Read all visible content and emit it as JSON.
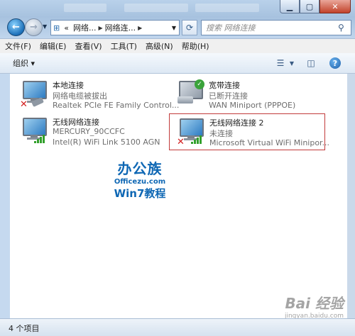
{
  "titlebar": {
    "min_icon": "minimize-icon",
    "max_icon": "maximize-icon",
    "close_icon": "close-icon"
  },
  "address": {
    "prefix": "«",
    "crumbs": [
      "网络...",
      "网络连..."
    ],
    "refresh_icon": "refresh-icon",
    "search_placeholder": "搜索 网络连接"
  },
  "menu": [
    "文件(F)",
    "编辑(E)",
    "查看(V)",
    "工具(T)",
    "高级(N)",
    "帮助(H)"
  ],
  "toolbar": {
    "organize": "组织 ▾",
    "help": "?"
  },
  "items": [
    {
      "name": "本地连接",
      "status": "网络电缆被拔出",
      "device": "Realtek PCIe FE Family Control...",
      "icon": "ethernet-disconnected-icon"
    },
    {
      "name": "宽带连接",
      "status": "已断开连接",
      "device": "WAN Miniport (PPPOE)",
      "icon": "broadband-icon"
    },
    {
      "name": "无线网络连接",
      "status": "MERCURY_90CCFC",
      "device": "Intel(R) WiFi Link 5100 AGN",
      "icon": "wireless-connected-icon"
    },
    {
      "name": "无线网络连接 2",
      "status": "未连接",
      "device": "Microsoft Virtual WiFi Minipor...",
      "icon": "wireless-disconnected-icon"
    }
  ],
  "logo": {
    "line1": "办公族",
    "line2": "Officezu.com",
    "line3": "Win7教程"
  },
  "watermark": {
    "line1": "Bai 经验",
    "line2": "jingyan.baidu.com"
  },
  "status": {
    "count": "4 个项目"
  },
  "colors": {
    "selection_border": "#c23a3a",
    "signal_green": "#32a02c",
    "error_red": "#d21f1f"
  }
}
